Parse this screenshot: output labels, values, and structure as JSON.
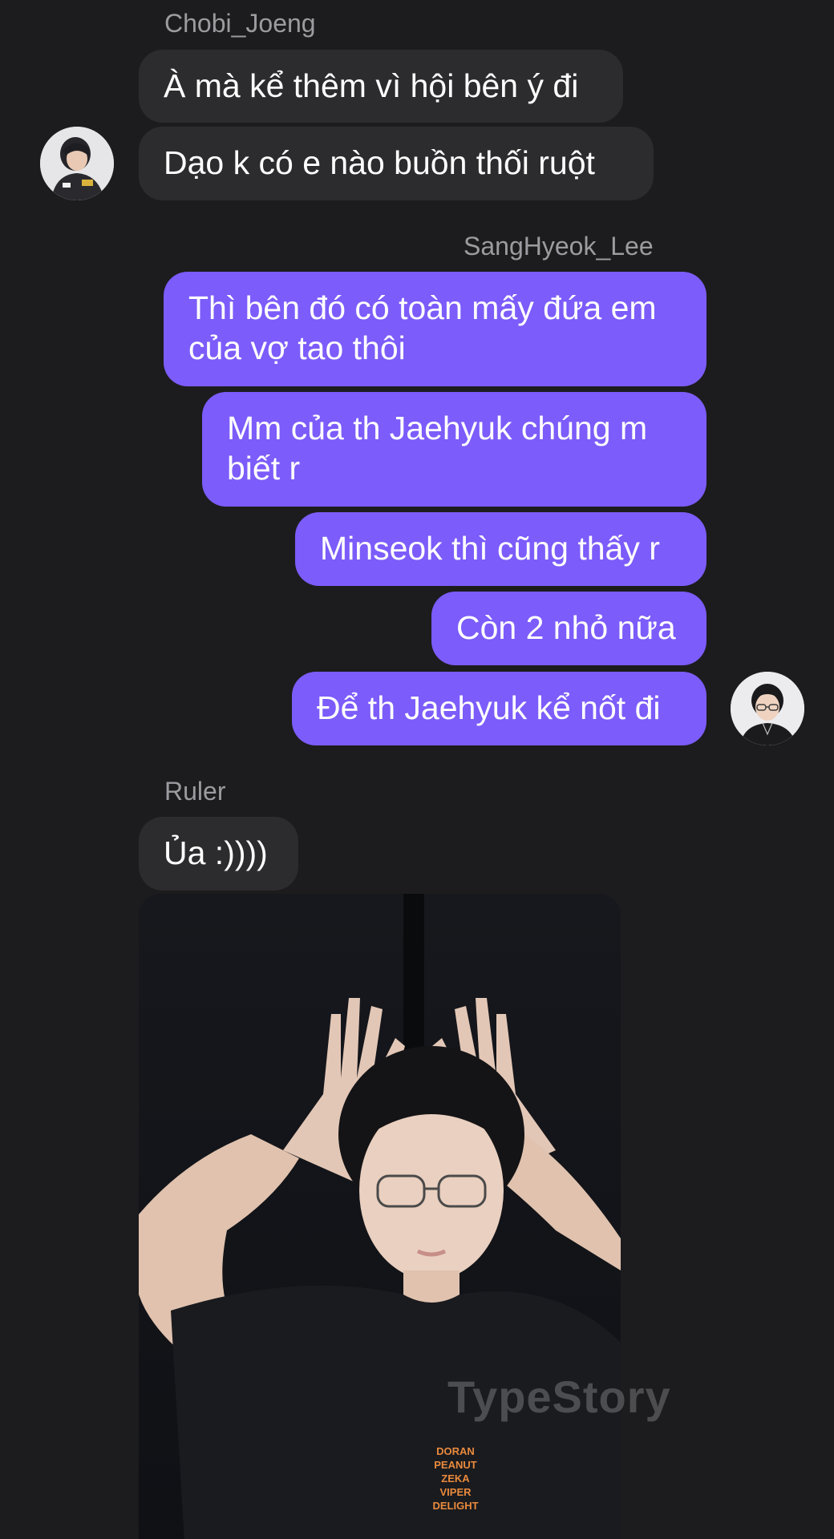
{
  "messages": {
    "group1": {
      "sender": "Chobi_Joeng",
      "bubbles": [
        "À mà kể thêm vì hội bên ý đi",
        "Dạo k có e nào buồn thối ruột"
      ]
    },
    "group2": {
      "sender": "SangHyeok_Lee",
      "bubbles": [
        "Thì bên đó có toàn mấy đứa em của vợ tao thôi",
        "Mm của th Jaehyuk chúng m biết r",
        "Minseok thì cũng thấy r",
        "Còn 2 nhỏ nữa",
        "Để th Jaehyuk kể nốt đi"
      ]
    },
    "group3": {
      "sender": "Ruler",
      "bubbles": [
        "Ủa :))))"
      ],
      "photo_shirt_text": [
        "DORAN",
        "PEANUT",
        "ZEKA",
        "VIPER",
        "DELIGHT"
      ]
    }
  },
  "watermark": "TypeStory",
  "colors": {
    "background": "#1c1c1e",
    "incoming_bubble": "#2c2c2e",
    "outgoing_bubble": "#7c5cfa",
    "sender_name": "#9b9ba0"
  }
}
